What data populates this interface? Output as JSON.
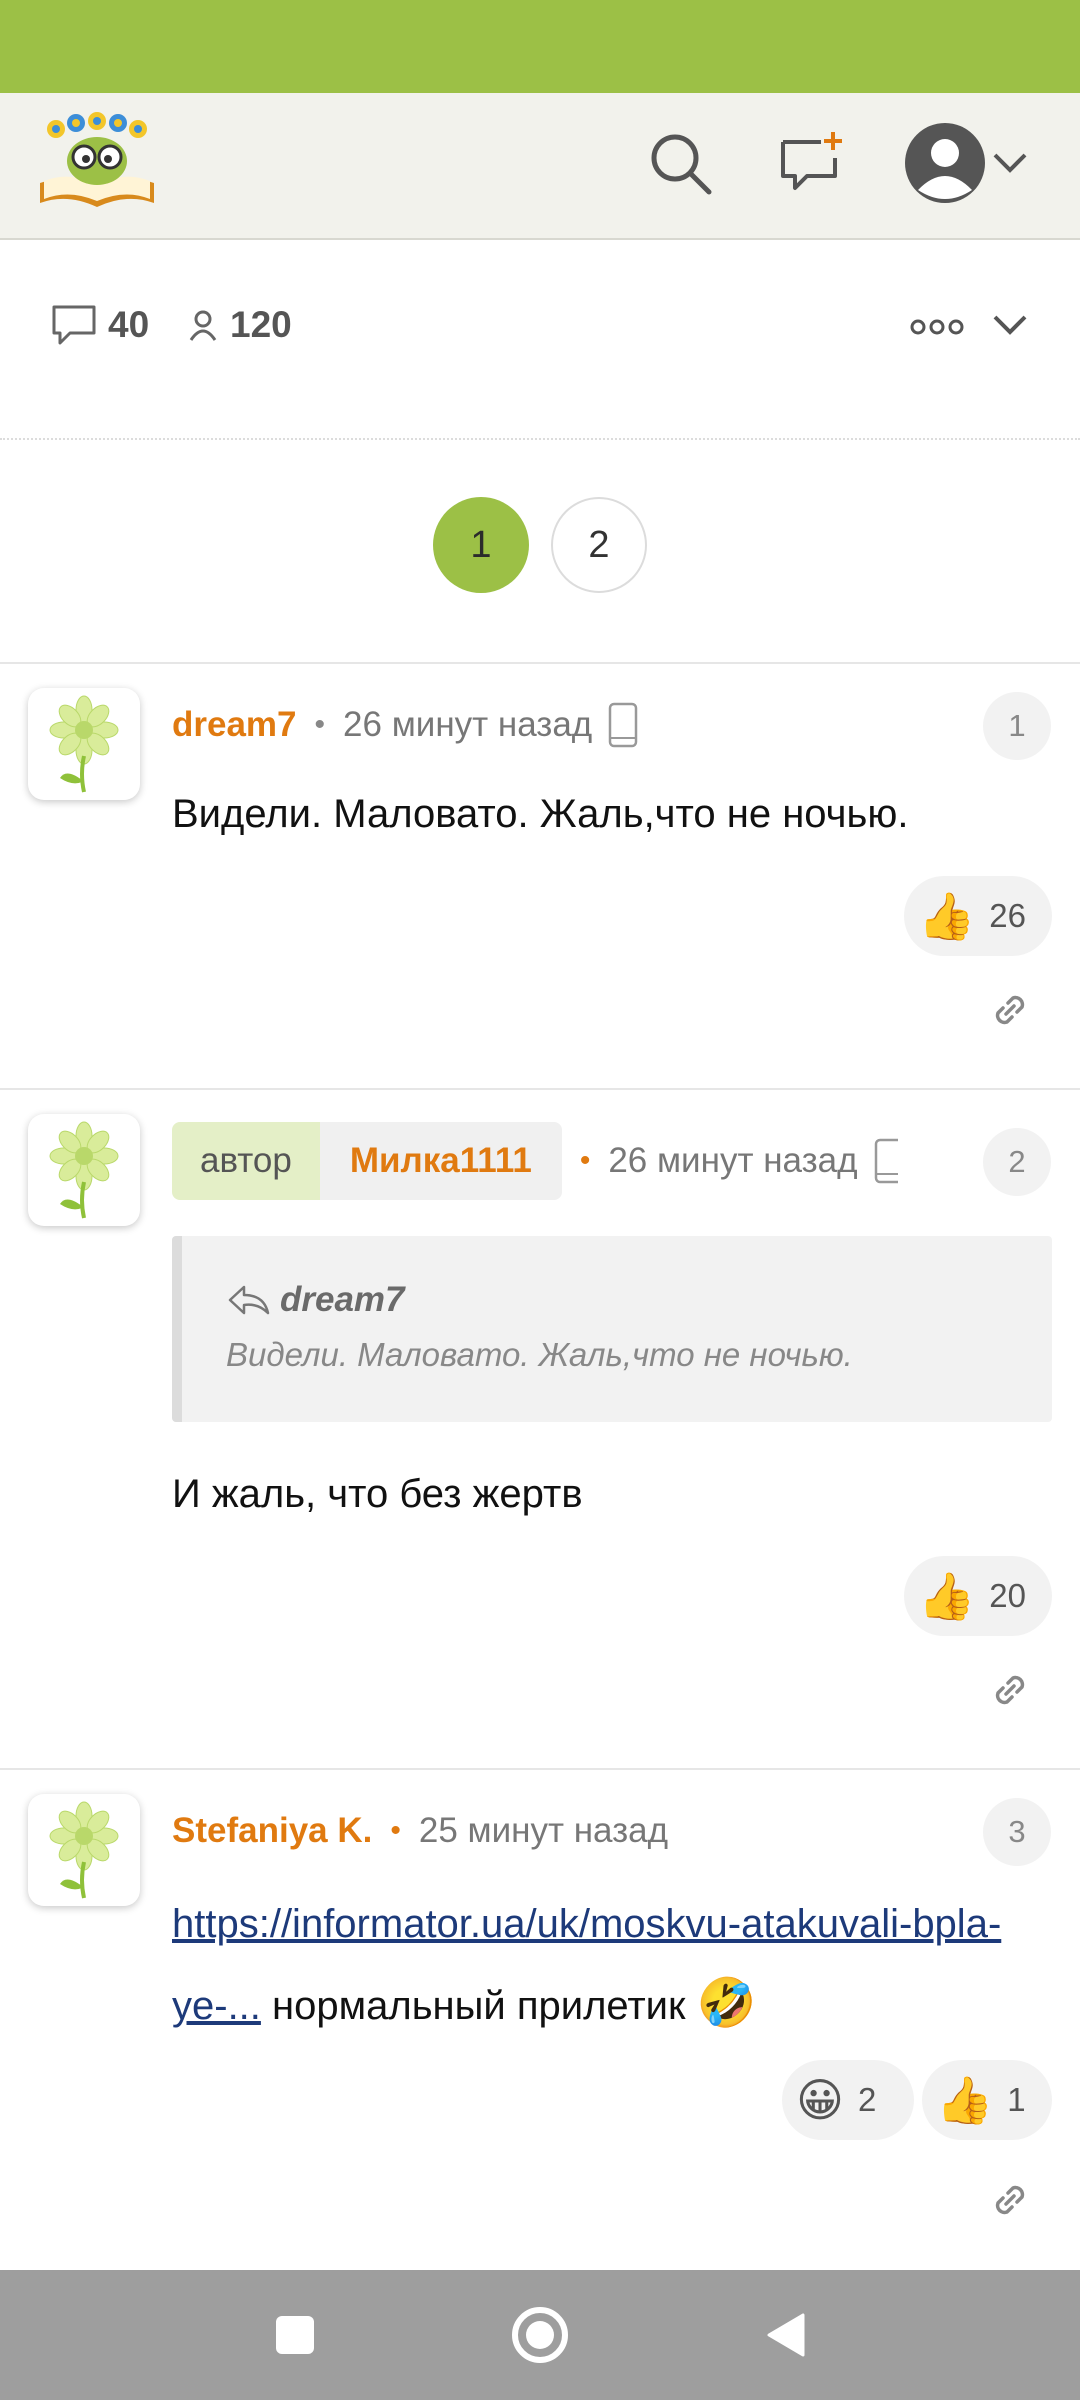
{
  "header": {
    "logo_alt": "logo",
    "icons": {
      "search": "search-icon",
      "new_topic": "new-message-icon",
      "profile": "user-avatar-icon",
      "menu": "chevron-down-icon"
    }
  },
  "topic": {
    "comments_count": "40",
    "participants_count": "120"
  },
  "pagination": {
    "pages": [
      "1",
      "2"
    ],
    "current": "1"
  },
  "comments": [
    {
      "author": "dream7",
      "time": "26 минут назад",
      "number": "1",
      "text": "Видели. Маловато. Жаль,что не ночью.",
      "reactions": [
        {
          "emoji": "👍",
          "count": "26"
        }
      ]
    },
    {
      "author_role": "автор",
      "author": "Милка1111",
      "time": "26 минут назад",
      "number": "2",
      "quote": {
        "author": "dream7",
        "text": "Видели. Маловато. Жаль,что не ночью."
      },
      "text": "И жаль, что без жертв",
      "reactions": [
        {
          "emoji": "👍",
          "count": "20"
        }
      ]
    },
    {
      "author": "Stefaniya K.",
      "time": "25 минут назад",
      "number": "3",
      "link_text": "https://informator.ua/uk/moskvu-atakuvali-bpla-ye-...",
      "text_after": " нормальный прилетик ",
      "emoji": "🤣",
      "reactions": [
        {
          "emoji": "😀",
          "count": "2"
        },
        {
          "emoji": "👍",
          "count": "1"
        }
      ]
    }
  ],
  "colors": {
    "accent_green": "#9cc046",
    "author_orange": "#e07a10",
    "link_blue": "#1d3a7a"
  }
}
